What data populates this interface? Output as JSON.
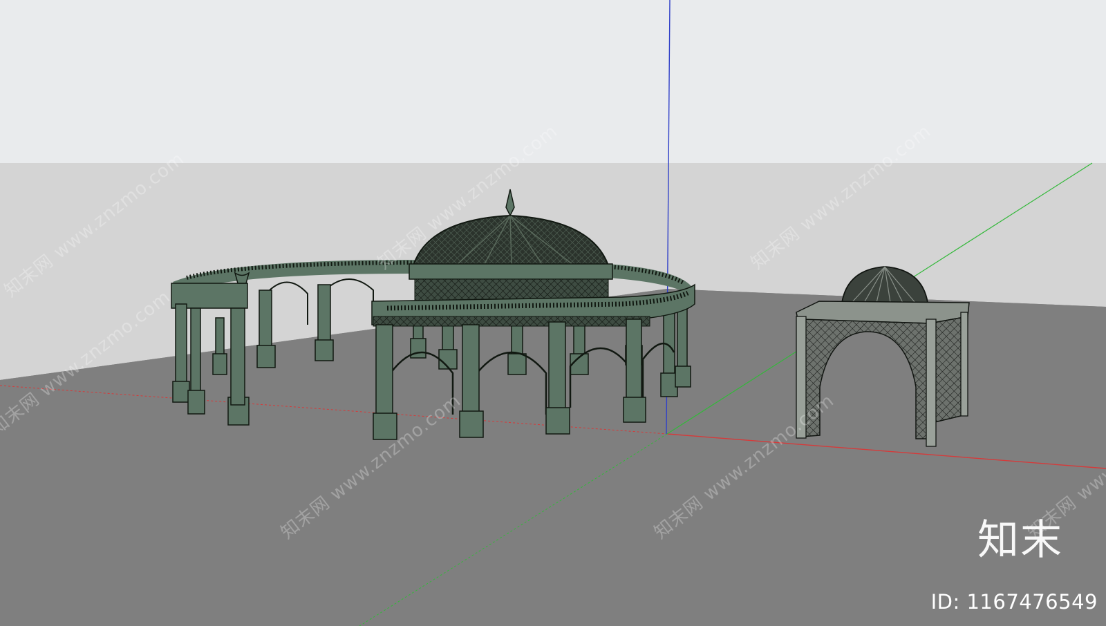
{
  "viewport": {
    "sky_color": "#e9ebed",
    "backdrop_color": "#d4d4d4",
    "ground_color": "#7f7f7f",
    "axis_colors": {
      "red": "#d63a3a",
      "green": "#33b83a",
      "blue": "#3040c8"
    }
  },
  "models": [
    {
      "name": "Circular colonnade pavilion with dome",
      "structure_color": "#5c7565",
      "outline_color": "#111811"
    },
    {
      "name": "Small square gazebo with dome",
      "structure_color": "#8a918a",
      "outline_color": "#1a1d1a"
    }
  ],
  "watermark": {
    "repeat_text": "知末网 www.znzmo.com",
    "logo_text": "知末",
    "id_label": "ID: 1167476549"
  }
}
